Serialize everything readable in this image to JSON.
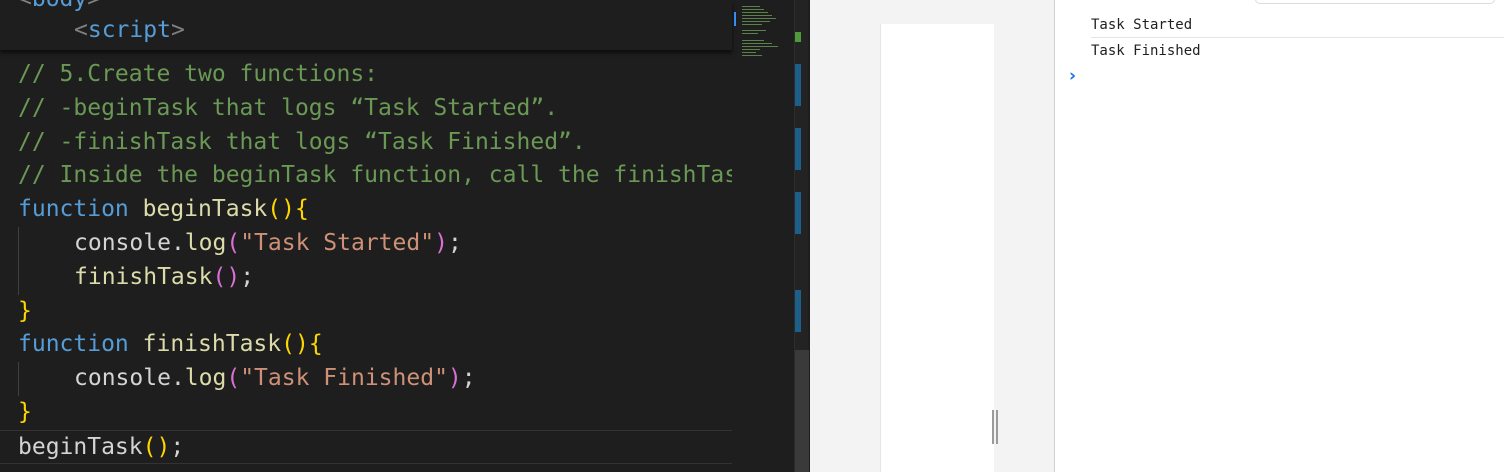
{
  "editor": {
    "sticky_lines": [
      {
        "open": "<",
        "name": "body",
        "close": ">"
      },
      {
        "open": "<",
        "name": "script",
        "close": ">"
      }
    ],
    "comments": [
      "// 5.Create two functions:",
      "// -beginTask that logs “Task Started”.",
      "// -finishTask that logs “Task Finished”.",
      "// Inside the beginTask function, call the finishTask"
    ],
    "keyword_function": "function",
    "fn_begin": "beginTask",
    "fn_finish": "finishTask",
    "console_obj": "console",
    "log_method": "log",
    "str_started": "\"Task Started\"",
    "str_finished": "\"Task Finished\"",
    "paren_open": "(",
    "paren_close": ")",
    "brace_open": "{",
    "brace_close": "}",
    "dot": ".",
    "semicolon": ";"
  },
  "console": {
    "messages": [
      "Task Started",
      "Task Finished"
    ],
    "prompt_icon": "chevron-right-icon"
  },
  "colors": {
    "editor_bg": "#1e1e1e",
    "comment": "#6a9955",
    "keyword": "#569cd6",
    "function": "#dcdcaa",
    "string": "#ce9178",
    "bracket_level1": "#ffd700",
    "bracket_level2": "#da70d6",
    "console_prompt": "#1a73e8"
  }
}
